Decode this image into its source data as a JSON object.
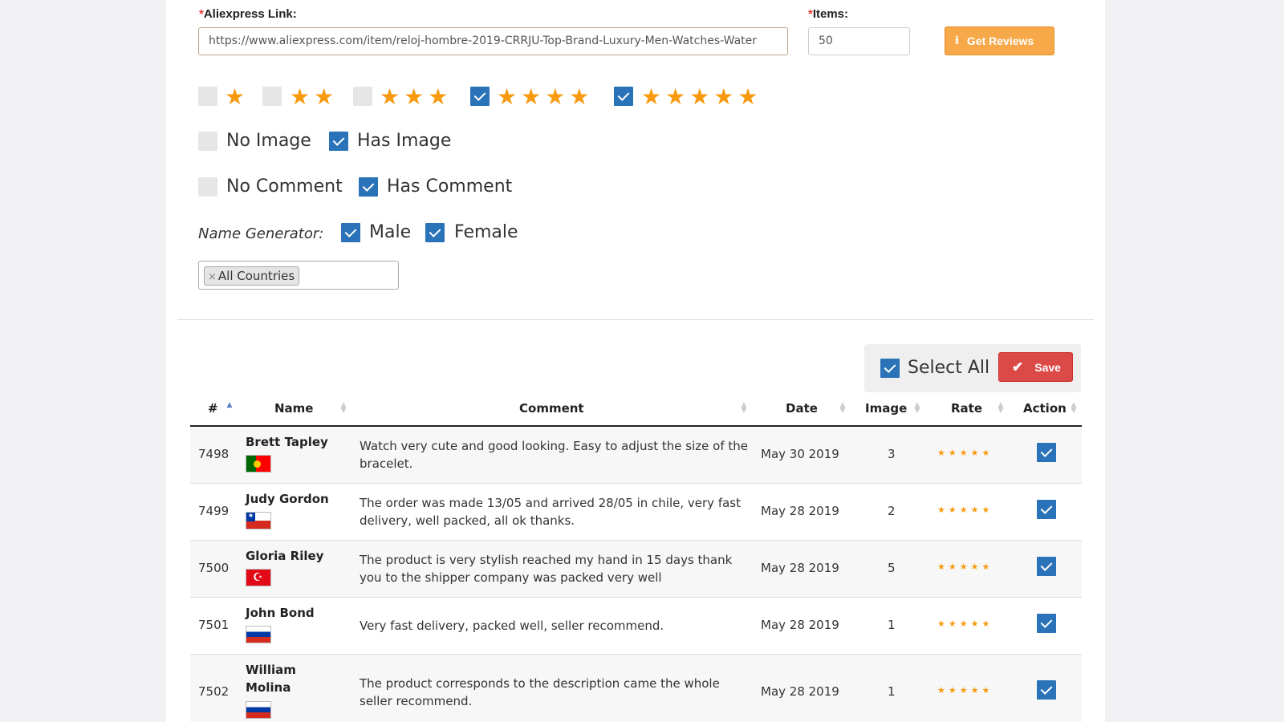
{
  "form": {
    "link_label": "Aliexpress Link:",
    "link_value": "https://www.aliexpress.com/item/reloj-hombre-2019-CRRJU-Top-Brand-Luxury-Men-Watches-Water",
    "items_label": "Items:",
    "items_value": "50",
    "required_mark": "*",
    "get_reviews_label": "Get Reviews"
  },
  "ratings": [
    {
      "stars": "★",
      "checked": false
    },
    {
      "stars": "★★",
      "checked": false
    },
    {
      "stars": "★★★",
      "checked": false
    },
    {
      "stars": "★★★★",
      "checked": true
    },
    {
      "stars": "★★★★★",
      "checked": true
    }
  ],
  "filters": {
    "no_image": "No Image",
    "has_image": "Has Image",
    "no_comment": "No Comment",
    "has_comment": "Has Comment",
    "name_generator_label": "Name Generator:",
    "male": "Male",
    "female": "Female",
    "country_tag": "All Countries",
    "tag_remove": "×"
  },
  "toolbar": {
    "select_all": "Select All",
    "save": "Save"
  },
  "table": {
    "columns": [
      "#",
      "Name",
      "Comment",
      "Date",
      "Image",
      "Rate",
      "Action"
    ],
    "rows": [
      {
        "id": "7498",
        "name": "Brett Tapley",
        "country": "Portugal",
        "comment": "Watch very cute and good looking. Easy to adjust the size of the bracelet.",
        "date": "May 30 2019",
        "image": "3",
        "rate": "★★★★★",
        "rate_value": 5,
        "checked": true
      },
      {
        "id": "7499",
        "name": "Judy Gordon",
        "country": "Chile",
        "comment": "The order was made 13/05 and arrived 28/05 in chile, very fast delivery, well packed, all ok thanks.",
        "date": "May 28 2019",
        "image": "2",
        "rate": "★★★★★",
        "rate_value": 5,
        "checked": true
      },
      {
        "id": "7500",
        "name": "Gloria Riley",
        "country": "Turkey",
        "comment": "The product is very stylish reached my hand in 15 days thank you to the shipper company was packed very well",
        "date": "May 28 2019",
        "image": "5",
        "rate": "★★★★★",
        "rate_value": 5,
        "checked": true
      },
      {
        "id": "7501",
        "name": "John Bond",
        "country": "Russia",
        "comment": "Very fast delivery, packed well, seller recommend.",
        "date": "May 28 2019",
        "image": "1",
        "rate": "★★★★★",
        "rate_value": 5,
        "checked": true
      },
      {
        "id": "7502",
        "name": "William Molina",
        "country": "Russia",
        "comment": "The product corresponds to the description came the whole seller recommend.",
        "date": "May 28 2019",
        "image": "1",
        "rate": "★★★★★",
        "rate_value": 5,
        "checked": true
      }
    ]
  },
  "colors": {
    "accent_orange": "#f7a94a",
    "star": "#f79a0f",
    "checkbox_blue": "#2a73b8",
    "save_red": "#dc4a47"
  }
}
